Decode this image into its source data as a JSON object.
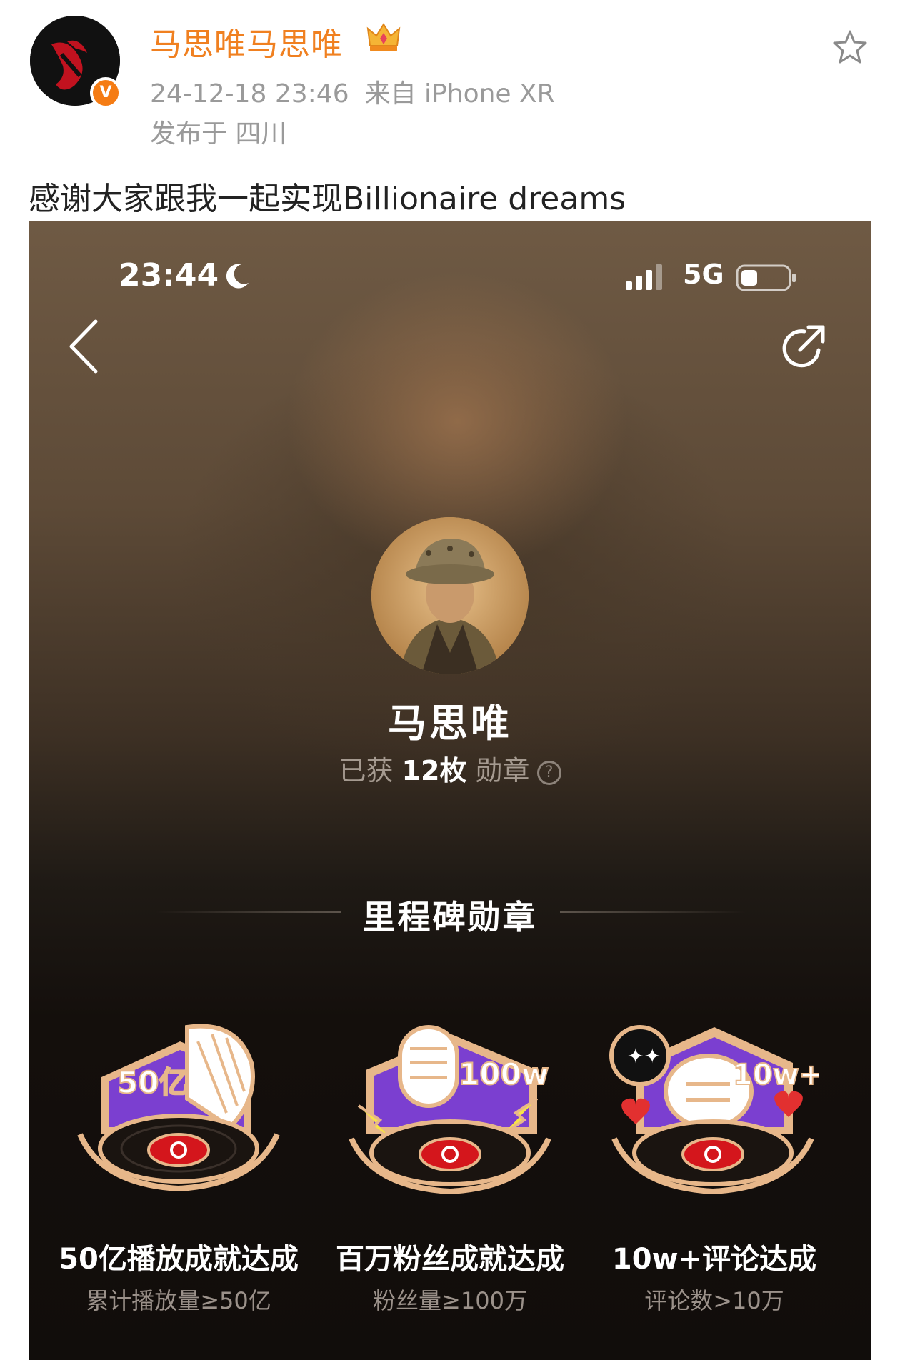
{
  "post": {
    "author": "马思唯马思唯",
    "timestamp": "24-12-18 23:46",
    "source": "来自 iPhone XR",
    "location": "发布于 四川",
    "text": "感谢大家跟我一起实现Billionaire dreams",
    "verified_badge": "V"
  },
  "screenshot": {
    "status_bar": {
      "time": "23:44",
      "network": "5G"
    },
    "profile": {
      "name": "马思唯",
      "badge_prefix": "已获",
      "badge_count": "12枚",
      "badge_suffix": "勋章"
    },
    "section_title": "里程碑勋章",
    "medals": [
      {
        "badge_text": "50亿",
        "title": "50亿播放成就达成",
        "subtitle": "累计播放量≥50亿"
      },
      {
        "badge_text": "100w",
        "title": "百万粉丝成就达成",
        "subtitle": "粉丝量≥100万"
      },
      {
        "badge_text": "10w+",
        "title": "10w+评论达成",
        "subtitle": "评论数>10万"
      }
    ]
  },
  "colors": {
    "author": "#f08020",
    "meta": "#9a9a9a",
    "medal_gold": "#e7b78a",
    "medal_purple": "#7b3fd0",
    "medal_red": "#d4161c"
  }
}
